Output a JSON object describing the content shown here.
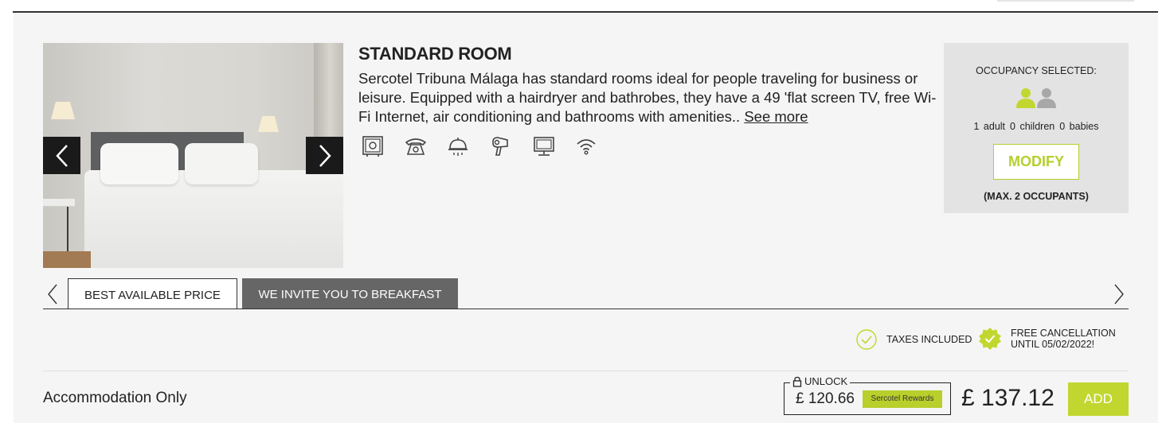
{
  "room": {
    "title": "STANDARD ROOM",
    "description": "Sercotel Tribuna Málaga has standard rooms ideal for people traveling for business or leisure. Equipped with a hairdryer and bathrobes, they have a 49 'flat screen TV, free Wi-Fi Internet, air conditioning and bathrooms with amenities.. ",
    "see_more": "See more",
    "amenities": [
      "safe-icon",
      "telephone-icon",
      "room-service-icon",
      "hairdryer-icon",
      "tv-icon",
      "wifi-icon"
    ]
  },
  "occupancy": {
    "label": "OCCUPANCY SELECTED:",
    "adults": "1 adult",
    "children": "0 children",
    "babies": "0 babies",
    "modify": "MODIFY",
    "max": "(MAX. 2 OCCUPANTS)"
  },
  "tabs": [
    {
      "label": "BEST AVAILABLE PRICE",
      "active": true
    },
    {
      "label": "WE INVITE YOU TO BREAKFAST",
      "active": false
    }
  ],
  "badges": {
    "taxes": "TAXES INCLUDED",
    "cancel_line1": "FREE CANCELLATION",
    "cancel_line2": "UNTIL 05/02/2022!"
  },
  "rate": {
    "name": "Accommodation Only",
    "unlock": "UNLOCK",
    "member_price": "£ 120.66",
    "rewards": "Sercotel Rewards",
    "price": "£ 137.12",
    "add": "ADD"
  },
  "colors": {
    "accent": "#c1d72f",
    "dark": "#1a1a1a",
    "panel": "#e3e3e3",
    "tab_inactive": "#666666"
  }
}
